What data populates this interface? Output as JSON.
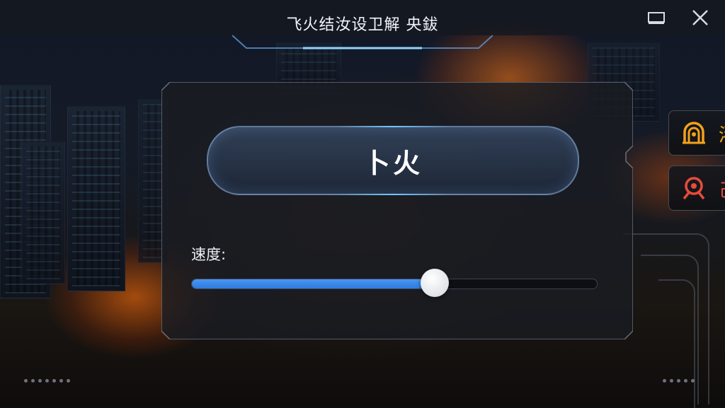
{
  "window": {
    "title": "飞火结汝设卫解 央鈸",
    "maximize_icon": "maximize-icon",
    "close_icon": "close-icon"
  },
  "main": {
    "start_button_label": "卜火",
    "speed_label": "速度:",
    "speed_value": 0.6
  },
  "side_buttons": [
    {
      "icon": "helmet-icon",
      "label": "濯",
      "color": "#f2a21b"
    },
    {
      "icon": "target-person-icon",
      "label": "己",
      "color": "#e64b3c"
    }
  ],
  "colors": {
    "accent": "#3a86e8",
    "glow": "#6fc8ff"
  }
}
